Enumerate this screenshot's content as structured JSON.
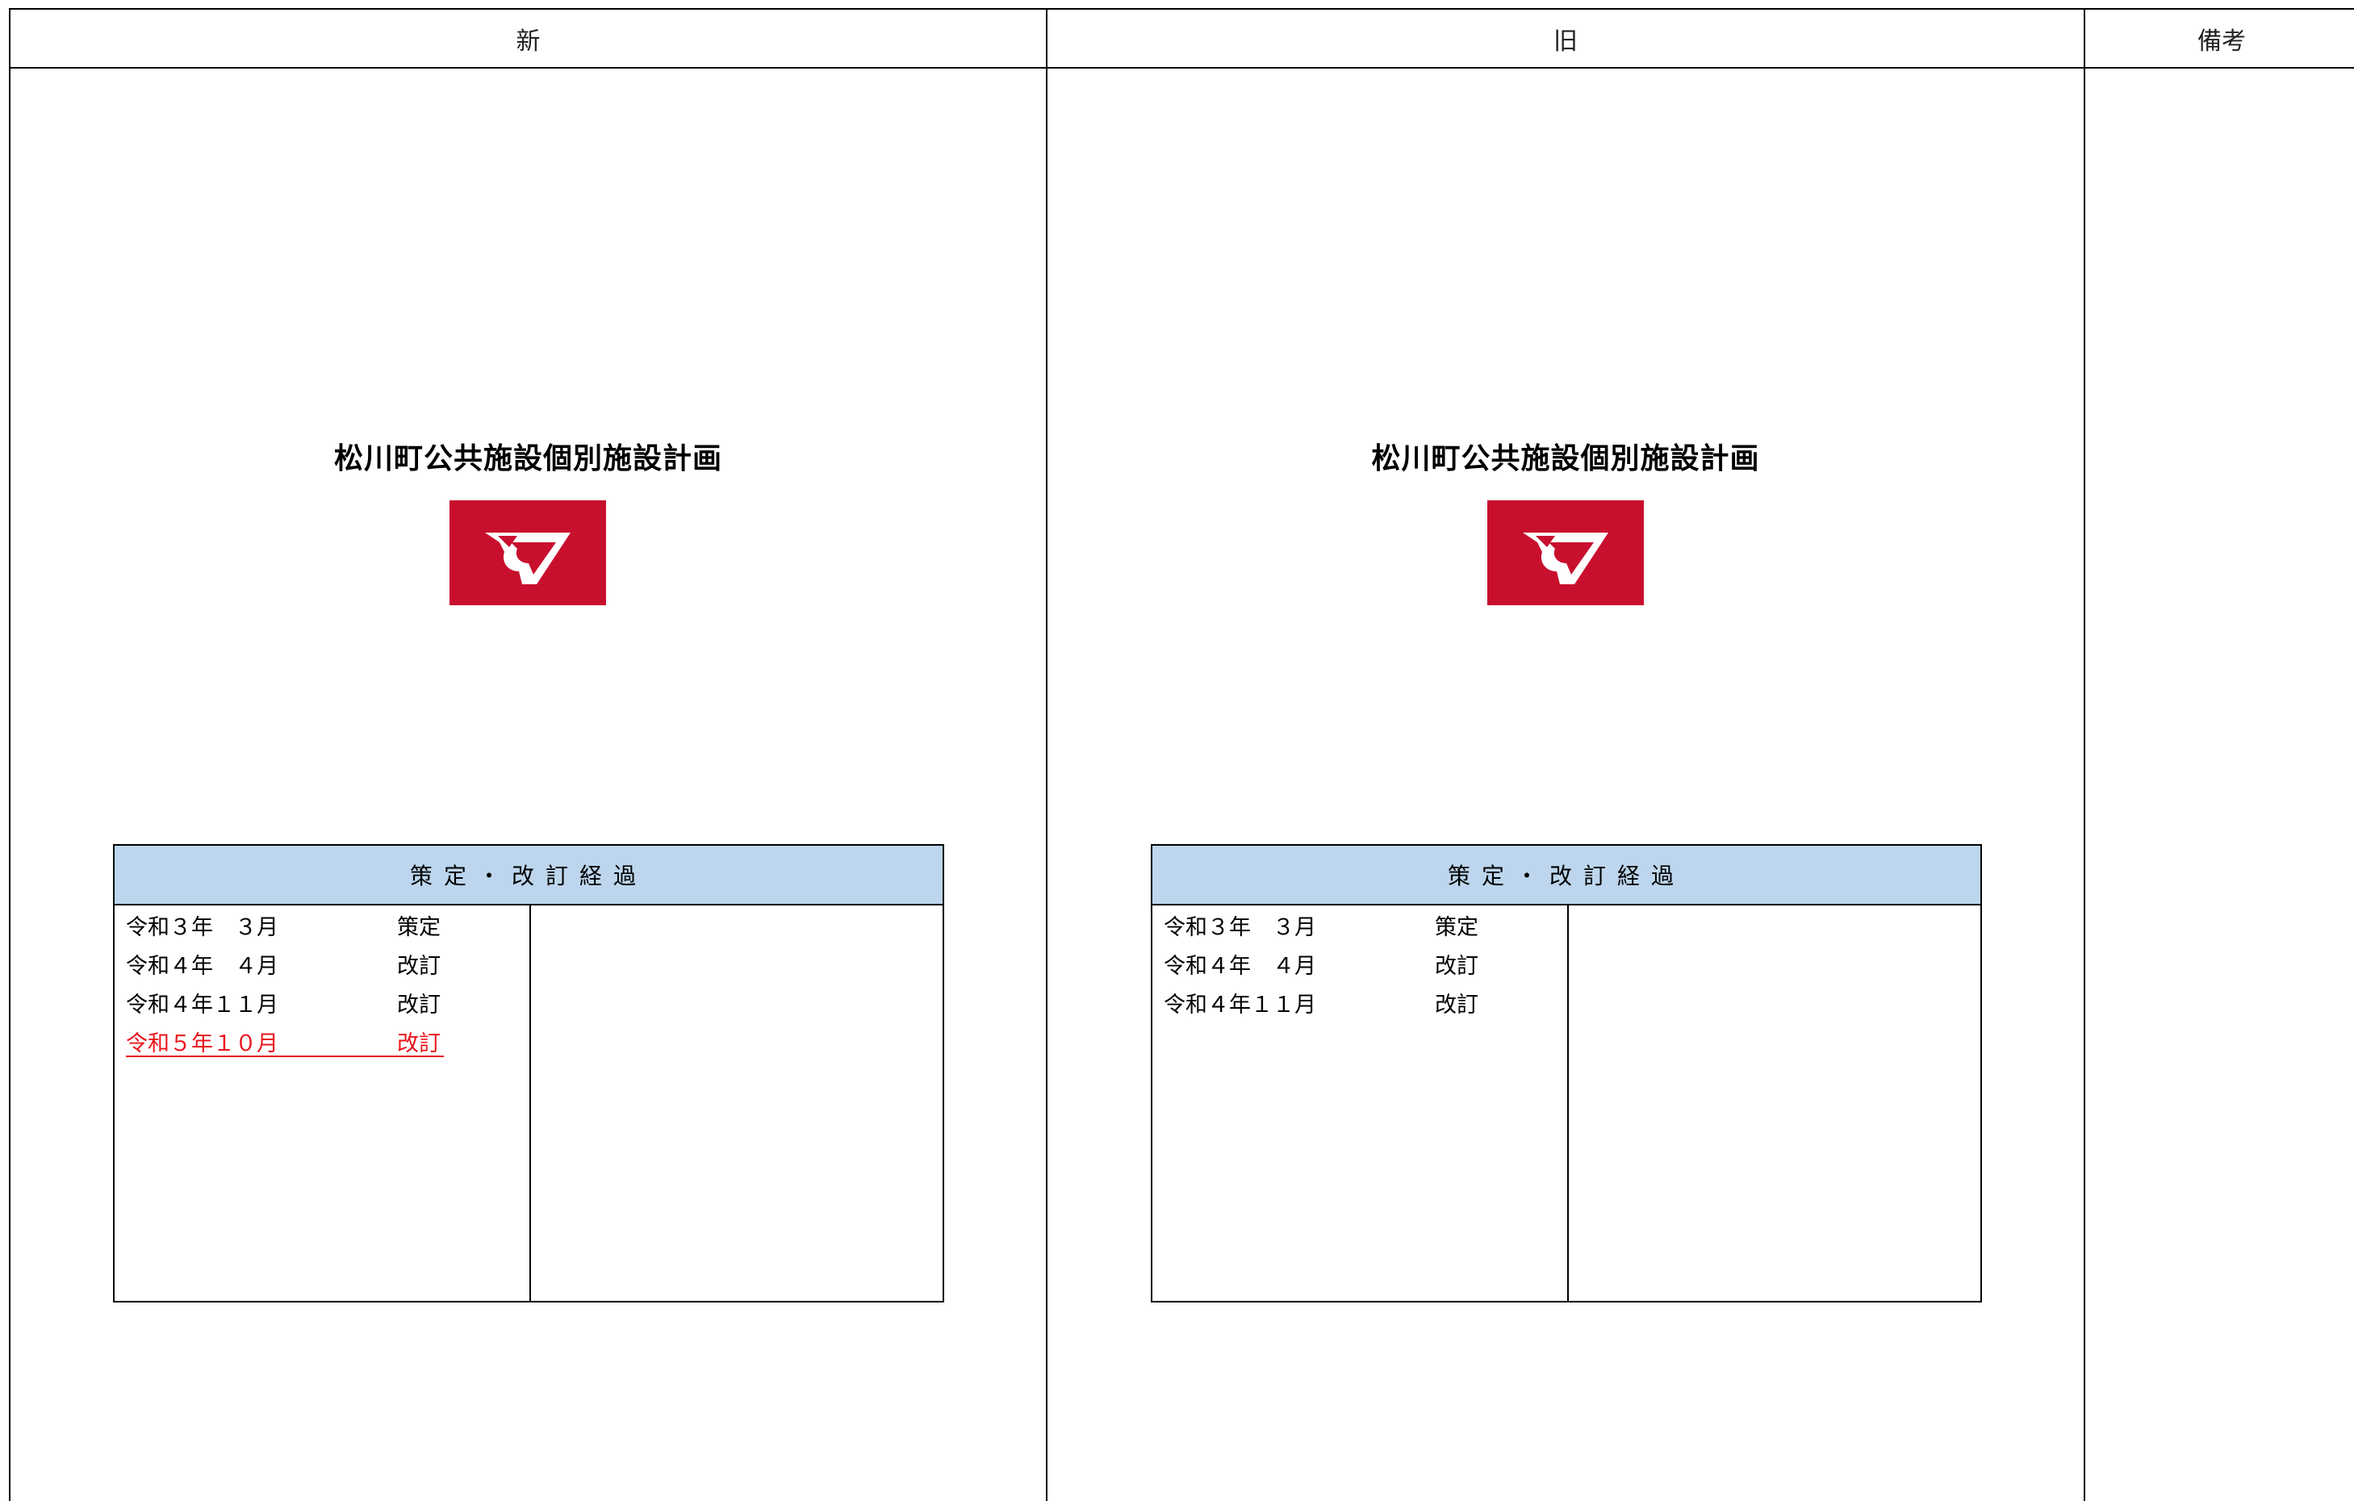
{
  "columns": {
    "new": "新",
    "old": "旧",
    "notes": "備考"
  },
  "panels": {
    "new": {
      "title": "松川町公共施設個別施設計画",
      "history_title": "策定・改訂経過",
      "rows": [
        {
          "date": "令和３年　３月",
          "action": "策定"
        },
        {
          "date": "令和４年　４月",
          "action": "改訂"
        },
        {
          "date": "令和４年１１月",
          "action": "改訂"
        },
        {
          "date": "令和５年１０月",
          "action": "改訂"
        }
      ]
    },
    "old": {
      "title": "松川町公共施設個別施設計画",
      "history_title": "策定・改訂経過",
      "rows": [
        {
          "date": "令和３年　３月",
          "action": "策定"
        },
        {
          "date": "令和４年　４月",
          "action": "改訂"
        },
        {
          "date": "令和４年１１月",
          "action": "改訂"
        }
      ]
    }
  },
  "colors": {
    "logo_red": "#c8102e",
    "history_header_blue": "#bdd6ee",
    "change_red": "#e8141b"
  },
  "icons": {
    "logo": "matsukawa-town-emblem-icon"
  }
}
